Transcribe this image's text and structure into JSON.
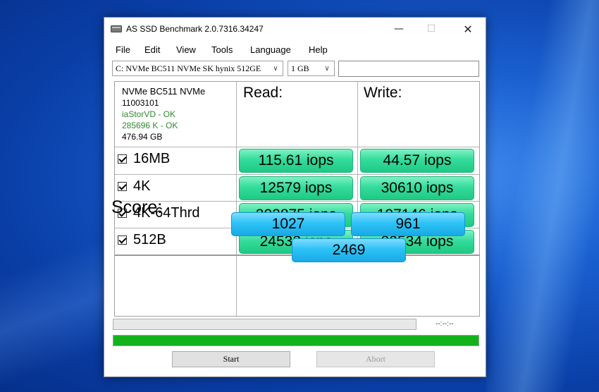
{
  "window": {
    "title": "AS SSD Benchmark 2.0.7316.34247",
    "controls": {
      "minimize": "—",
      "maximize": "☐",
      "close": "✕"
    }
  },
  "menu": [
    "File",
    "Edit",
    "View",
    "Tools",
    "Language",
    "Help"
  ],
  "drive_select": {
    "value": "C: NVMe BC511 NVMe SK hynix 512GE"
  },
  "size_select": {
    "value": "1 GB"
  },
  "text_box": {
    "value": ""
  },
  "info": {
    "model": "NVMe BC511 NVMe",
    "firmware": "11003101",
    "driver": "iaStorVD - OK",
    "alignment": "285696 K - OK",
    "capacity": "476.94 GB"
  },
  "headers": {
    "read": "Read:",
    "write": "Write:"
  },
  "rows": [
    {
      "label": "16MB",
      "checked": true,
      "read": "115.61 iops",
      "write": "44.57 iops"
    },
    {
      "label": "4K",
      "checked": true,
      "read": "12579 iops",
      "write": "30610 iops"
    },
    {
      "label": "4K-64Thrd",
      "checked": true,
      "read": "202875 iops",
      "write": "197146 iops"
    },
    {
      "label": "512B",
      "checked": true,
      "read": "24533 iops",
      "write": "32534 iops"
    }
  ],
  "score": {
    "label": "Score:",
    "read": "1027",
    "write": "961",
    "total": "2469"
  },
  "progress": {
    "time": "--:--:--",
    "overall_fraction": 1.0
  },
  "buttons": {
    "start": "Start",
    "abort": "Abort"
  },
  "colors": {
    "result_green": "#33dc9a",
    "score_blue": "#2ec3f5",
    "progress_green": "#13b21b",
    "ok_text": "#2e8b2e"
  }
}
